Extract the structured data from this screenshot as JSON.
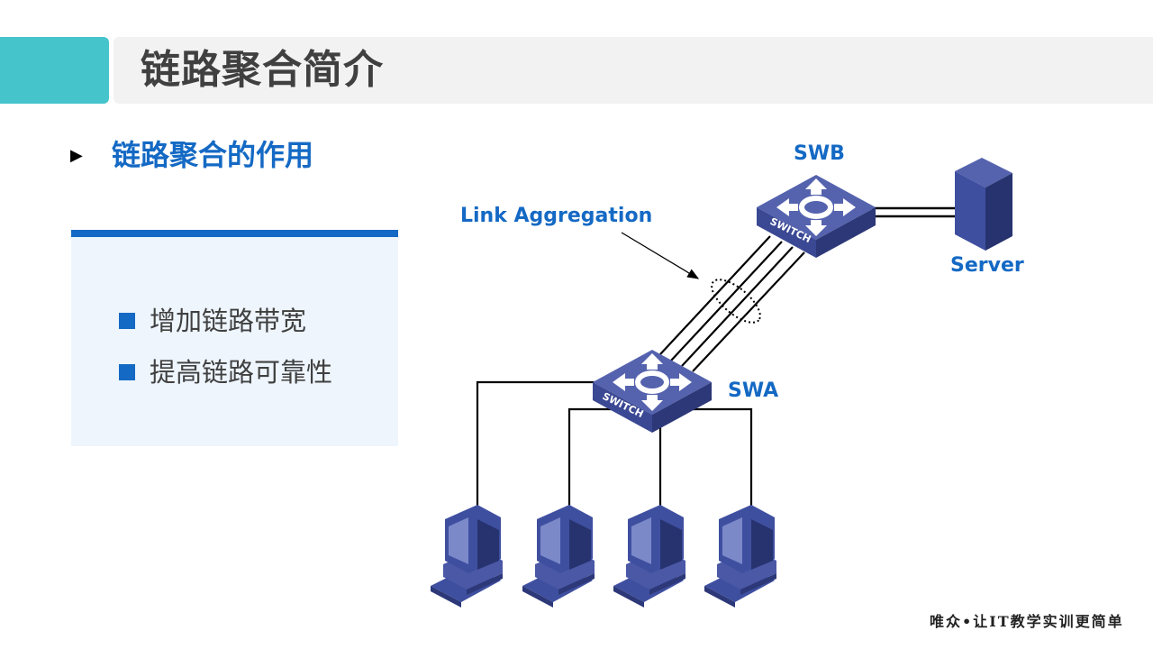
{
  "slide": {
    "title": "链路聚合简介",
    "section_title": "链路聚合的作用",
    "bullets": [
      "增加链路带宽",
      "提高链路可靠性"
    ],
    "footer": "唯众•让IT教学实训更简单"
  },
  "diagram": {
    "link_aggregation_label": "Link Aggregation",
    "nodes": {
      "swb": {
        "label": "SWB",
        "switch_text": "SWITCH"
      },
      "swa": {
        "label": "SWA",
        "switch_text": "SWITCH"
      },
      "server": {
        "label": "Server"
      }
    },
    "aggregated_link_count": 4,
    "server_link_count": 2,
    "pc_count": 4
  },
  "colors": {
    "accent_teal": "#45c4cc",
    "brand_blue": "#1469c4",
    "device_blue": "#3f4fa0",
    "title_gray": "#404040"
  }
}
